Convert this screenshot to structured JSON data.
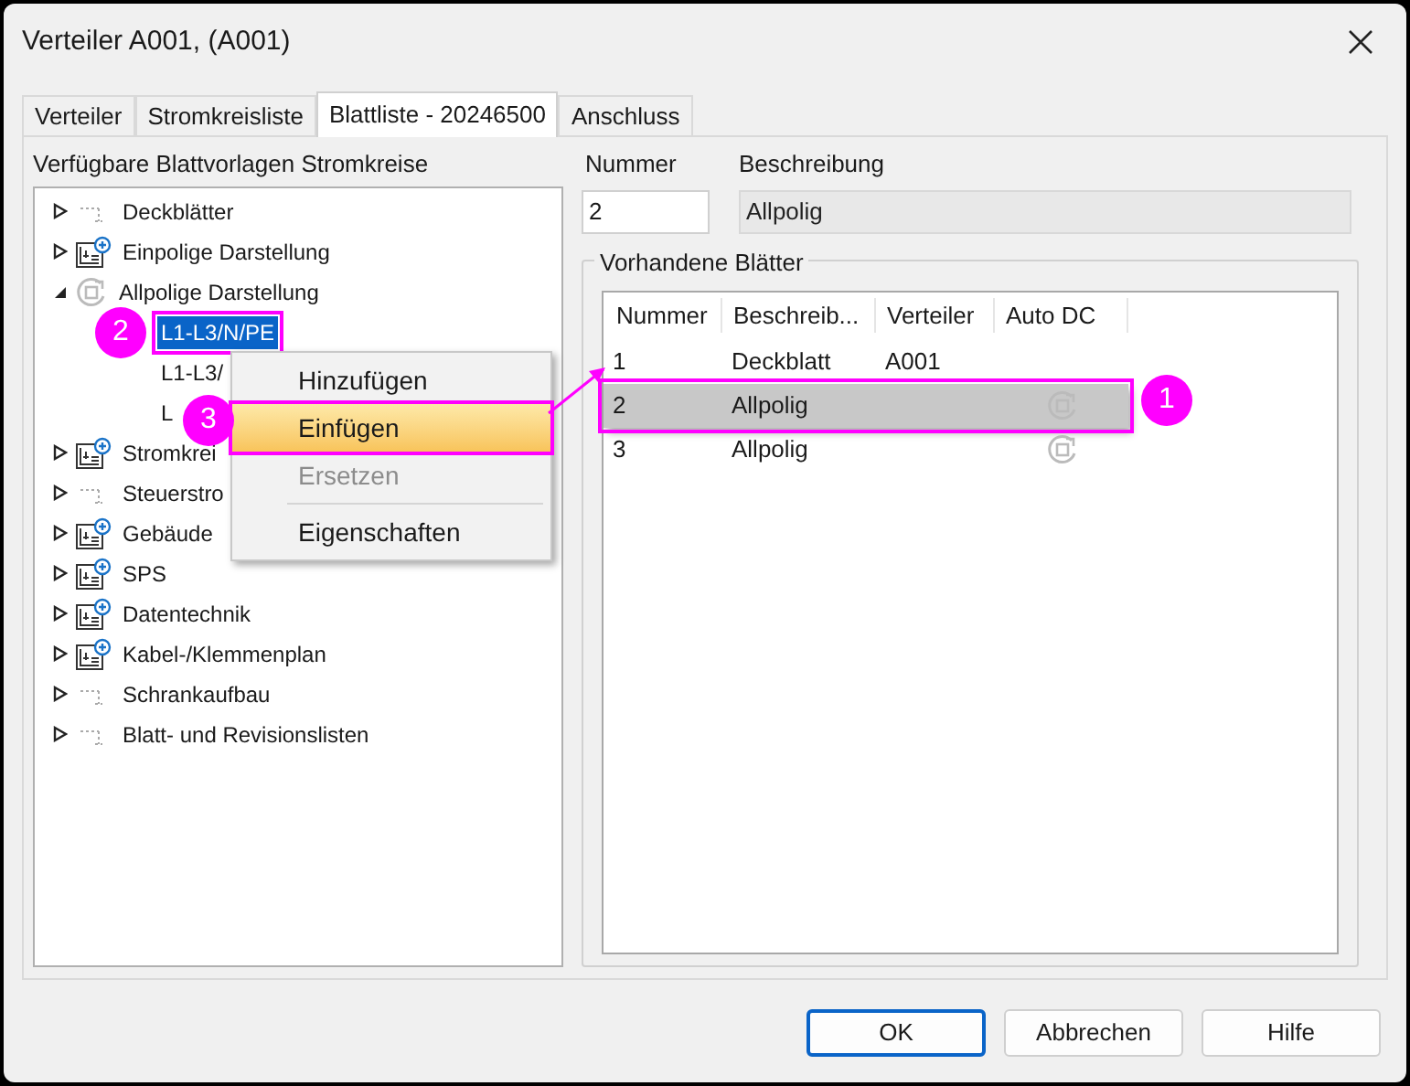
{
  "window": {
    "title": "Verteiler A001,  (A001)"
  },
  "tabs": [
    {
      "label": "Verteiler",
      "selected": false
    },
    {
      "label": "Stromkreisliste",
      "selected": false
    },
    {
      "label": "Blattliste - 20246500",
      "selected": true
    },
    {
      "label": "Anschluss",
      "selected": false
    }
  ],
  "tree": {
    "label": "Verfügbare Blattvorlagen Stromkreise",
    "items": [
      {
        "label": "Deckblätter",
        "kind": "dots",
        "expanded": false
      },
      {
        "label": "Einpolige Darstellung",
        "kind": "plus",
        "expanded": false
      },
      {
        "label": "Allpolige Darstellung",
        "kind": "circle",
        "expanded": true,
        "children": [
          {
            "label": "L1-L3/N/PE",
            "selected": true
          },
          {
            "label": "L1-L3/",
            "selected": false
          },
          {
            "label": "L",
            "selected": false
          }
        ]
      },
      {
        "label": "Stromkrei",
        "kind": "plus",
        "expanded": false
      },
      {
        "label": "Steuerstro",
        "kind": "dots",
        "expanded": false
      },
      {
        "label": "Gebäude",
        "kind": "plus",
        "expanded": false
      },
      {
        "label": "SPS",
        "kind": "plus",
        "expanded": false
      },
      {
        "label": "Datentechnik",
        "kind": "plus",
        "expanded": false
      },
      {
        "label": "Kabel-/Klemmenplan",
        "kind": "plus",
        "expanded": false
      },
      {
        "label": "Schrankaufbau",
        "kind": "dots",
        "expanded": false
      },
      {
        "label": "Blatt- und Revisionslisten",
        "kind": "dots",
        "expanded": false
      }
    ]
  },
  "nummer": {
    "label": "Nummer",
    "value": "2"
  },
  "beschreibung": {
    "label": "Beschreibung",
    "value": "Allpolig",
    "disabled": true
  },
  "sheets": {
    "title": "Vorhandene Blätter",
    "columns": [
      "Nummer",
      "Beschreib...",
      "Verteiler",
      "Auto DC"
    ],
    "rows": [
      {
        "nummer": "1",
        "beschreibung": "Deckblatt",
        "verteiler": "A001",
        "auto_dc": false,
        "selected": false
      },
      {
        "nummer": "2",
        "beschreibung": "Allpolig",
        "auto_dc": true,
        "selected": true
      },
      {
        "nummer": "3",
        "beschreibung": "Allpolig",
        "auto_dc": true,
        "selected": false
      }
    ]
  },
  "context_menu": [
    {
      "kind": "item",
      "label": "Hinzufügen",
      "highlighted": false,
      "disabled": false
    },
    {
      "kind": "item",
      "label": "Einfügen",
      "highlighted": true,
      "disabled": false
    },
    {
      "kind": "item",
      "label": "Ersetzen",
      "highlighted": false,
      "disabled": true
    },
    {
      "kind": "separator"
    },
    {
      "kind": "item",
      "label": "Eigenschaften",
      "highlighted": false,
      "disabled": false
    }
  ],
  "badges": [
    "1",
    "2",
    "3"
  ],
  "buttons": [
    {
      "label": "OK",
      "default": true
    },
    {
      "label": "Abbrechen",
      "default": false
    },
    {
      "label": "Hilfe",
      "default": false
    }
  ]
}
